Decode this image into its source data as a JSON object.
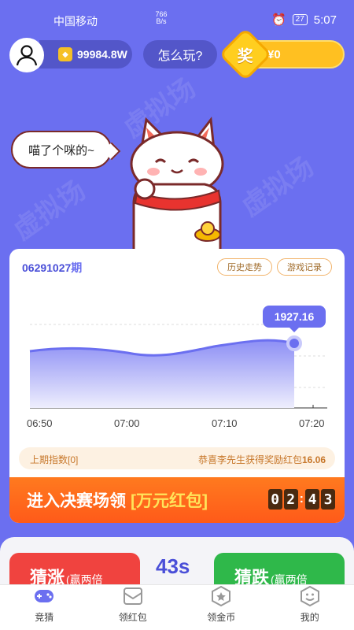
{
  "status_bar": {
    "carrier": "中国移动",
    "net_speed": "766 B/s",
    "battery": "27",
    "time": "5:07"
  },
  "header": {
    "coins": "99984.8W",
    "how_to_play": "怎么玩?",
    "reward_badge": "奖",
    "reward_amount": "¥0"
  },
  "mascot": {
    "speech": "喵了个咪的~"
  },
  "chart_card": {
    "period_number": "06291027",
    "period_suffix": "期",
    "history_button": "历史走势",
    "records_button": "游戏记录",
    "current_price": "1927.16",
    "last_index_label": "上期指数[0]",
    "congrats_prefix": "恭喜李先生获得奖励红包",
    "congrats_amount": "16.06"
  },
  "chart_data": {
    "type": "area",
    "x": [
      "06:50",
      "07:00",
      "07:10",
      "07:20"
    ],
    "x_ticks": [
      "06:50",
      "07:00",
      "07:10",
      "07:20"
    ],
    "y_approx": [
      1925.5,
      1925.7,
      1925.3,
      1926.0,
      1926.6,
      1927.16
    ],
    "last_value": 1927.16,
    "color": "#6b6ff0"
  },
  "final_banner": {
    "text": "进入决赛场领",
    "highlight": "[万元红包]",
    "timer": [
      "0",
      "2",
      ":",
      "4",
      "3"
    ]
  },
  "bet_panel": {
    "rise_label": "猜涨",
    "rise_odds": "(赢两倍",
    "countdown": "43s",
    "fall_label": "猜跌",
    "fall_odds": "(赢两倍"
  },
  "tabs": [
    {
      "label": "竞猜",
      "icon": "gamepad-icon"
    },
    {
      "label": "领红包",
      "icon": "envelope-icon"
    },
    {
      "label": "领金币",
      "icon": "star-shield-icon"
    },
    {
      "label": "我的",
      "icon": "smile-icon"
    }
  ]
}
